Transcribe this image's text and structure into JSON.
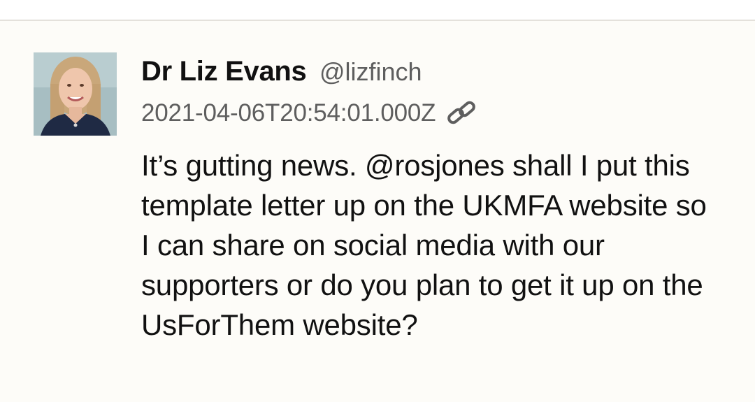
{
  "tweet": {
    "author_name": "Dr Liz Evans",
    "author_handle": "@lizfinch",
    "timestamp": "2021-04-06T20:54:01.000Z",
    "link_icon": "link-icon",
    "avatar_icon": "avatar",
    "text": "It’s gutting news. @rosjones shall I put this template letter up on the UKMFA website so I can share on social media with our supporters or do you plan to get it up on the UsForThem website?"
  },
  "colors": {
    "background": "#fdfcf8",
    "name": "#111111",
    "secondary": "#5e5e5e",
    "divider": "#e4e1db"
  }
}
